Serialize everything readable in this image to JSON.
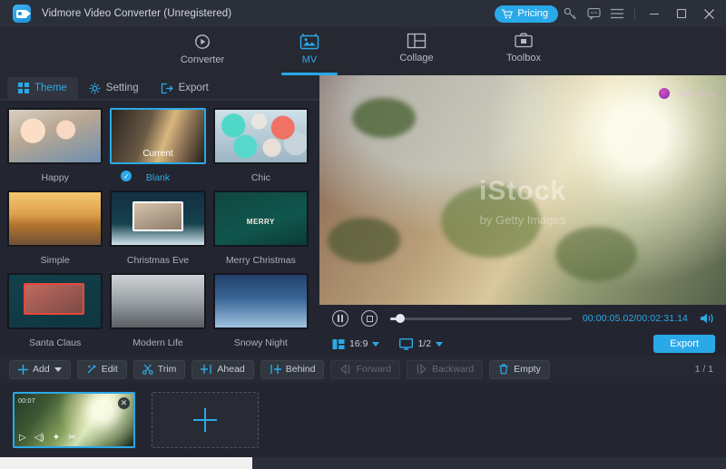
{
  "titlebar": {
    "app_name": "Vidmore Video Converter (Unregistered)",
    "logo_icon": "video-camera-icon",
    "pricing_label": "Pricing",
    "cart_icon": "shopping-cart-icon",
    "key_icon": "key-icon",
    "feedback_icon": "message-icon",
    "menu_icon": "hamburger-menu-icon",
    "minimize_icon": "minimize-icon",
    "maximize_icon": "maximize-icon",
    "close_icon": "close-icon",
    "accent_color": "#2aa9e8"
  },
  "mainnav": {
    "items": [
      {
        "label": "Converter",
        "icon": "converter-play-icon",
        "active": false
      },
      {
        "label": "MV",
        "icon": "mv-picture-icon",
        "active": true
      },
      {
        "label": "Collage",
        "icon": "collage-grid-icon",
        "active": false
      },
      {
        "label": "Toolbox",
        "icon": "toolbox-icon",
        "active": false
      }
    ]
  },
  "subtabs": {
    "items": [
      {
        "label": "Theme",
        "icon": "grid-squares-icon",
        "active": true
      },
      {
        "label": "Setting",
        "icon": "gear-icon",
        "active": false
      },
      {
        "label": "Export",
        "icon": "export-arrow-icon",
        "active": false
      }
    ]
  },
  "themes": [
    {
      "name": "Happy",
      "art": "a-happy",
      "selected": false,
      "badge": ""
    },
    {
      "name": "Blank",
      "art": "a-blank",
      "selected": true,
      "badge": "Current"
    },
    {
      "name": "Chic",
      "art": "a-chic",
      "selected": false,
      "badge": ""
    },
    {
      "name": "Simple",
      "art": "a-simple",
      "selected": false,
      "badge": ""
    },
    {
      "name": "Christmas Eve",
      "art": "a-xeve",
      "selected": false,
      "badge": ""
    },
    {
      "name": "Merry Christmas",
      "art": "a-merry",
      "selected": false,
      "badge": "MERRY"
    },
    {
      "name": "Santa Claus",
      "art": "a-santa",
      "selected": false,
      "badge": ""
    },
    {
      "name": "Modern Life",
      "art": "a-modern",
      "selected": false,
      "badge": ""
    },
    {
      "name": "Snowy Night",
      "art": "a-snowy",
      "selected": false,
      "badge": ""
    }
  ],
  "preview": {
    "watermark_main": "iStock",
    "watermark_sub": "by Getty Images",
    "corner_watermark": "lnstagBanc",
    "corner_logo_icon": "magenta-orb-icon"
  },
  "player": {
    "pause_icon": "pause-icon",
    "stop_icon": "stop-icon",
    "time_display": "00:00:05.02/00:02:31.14",
    "volume_icon": "volume-icon",
    "aspect_ratio": "16:9",
    "aspect_icon": "aspect-ratio-icon",
    "screen_split": "1/2",
    "screen_icon": "monitor-icon",
    "export_label": "Export"
  },
  "toolbar": {
    "buttons": [
      {
        "label": "Add",
        "glyph": "+",
        "icon": "plus-icon",
        "dropdown": true,
        "disabled": false
      },
      {
        "label": "Edit",
        "glyph": "✎",
        "icon": "magic-wand-icon",
        "dropdown": false,
        "disabled": false
      },
      {
        "label": "Trim",
        "glyph": "✂",
        "icon": "scissors-icon",
        "dropdown": false,
        "disabled": false
      },
      {
        "label": "Ahead",
        "glyph": "+|",
        "icon": "insert-ahead-icon",
        "dropdown": false,
        "disabled": false
      },
      {
        "label": "Behind",
        "glyph": "|+",
        "icon": "insert-behind-icon",
        "dropdown": false,
        "disabled": false
      },
      {
        "label": "Forward",
        "glyph": "◁|",
        "icon": "move-forward-icon",
        "dropdown": false,
        "disabled": true
      },
      {
        "label": "Backward",
        "glyph": "|▷",
        "icon": "move-backward-icon",
        "dropdown": false,
        "disabled": true
      },
      {
        "label": "Empty",
        "glyph": "🗑",
        "icon": "trash-icon",
        "dropdown": false,
        "disabled": false
      }
    ],
    "page_indicator": "1 / 1"
  },
  "timeline": {
    "clip": {
      "close_icon": "close-circle-icon",
      "mini_label": "00:07",
      "tools": [
        {
          "icon": "play-icon",
          "glyph": "▷"
        },
        {
          "icon": "volume-icon",
          "glyph": "◁)"
        },
        {
          "icon": "effects-icon",
          "glyph": "✦"
        },
        {
          "icon": "scissors-icon",
          "glyph": "✂"
        }
      ]
    },
    "add_placeholder_icon": "plus-icon"
  }
}
